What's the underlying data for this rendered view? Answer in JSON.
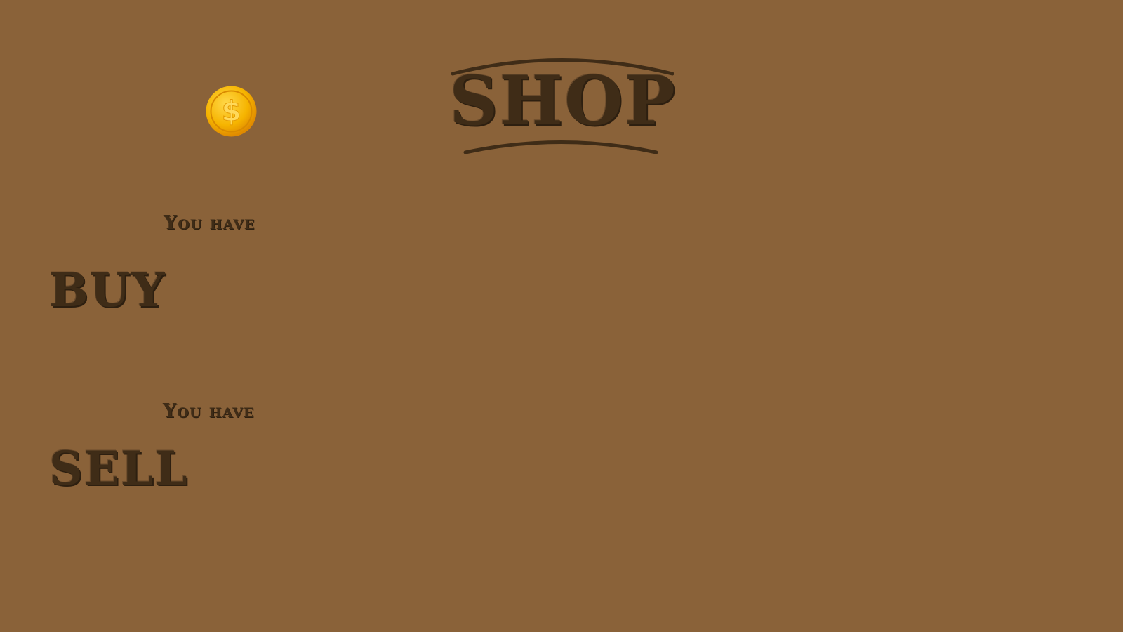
{
  "header": {
    "title": "SHOP",
    "currency_icon": "dollar-coin-icon"
  },
  "buy": {
    "label": "BUY",
    "you_have_label": "You have"
  },
  "sell": {
    "label": "SELL",
    "you_have_label": "You have"
  },
  "colors": {
    "background": "#8a6239",
    "ink": "#3f2c17",
    "coin": "#f5a300"
  }
}
